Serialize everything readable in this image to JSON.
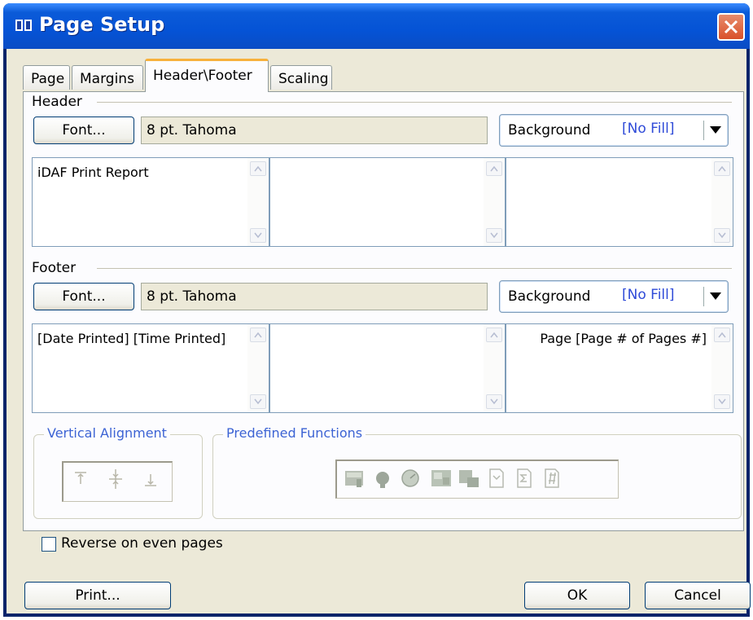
{
  "window": {
    "title": "Page Setup"
  },
  "tabs": [
    "Page",
    "Margins",
    "Header\\Footer",
    "Scaling"
  ],
  "header": {
    "section_label": "Header",
    "font_button": "Font...",
    "font_value": "8 pt. Tahoma",
    "background_label": "Background",
    "background_value": "[No Fill]",
    "left_text": "iDAF Print Report",
    "center_text": "",
    "right_text": ""
  },
  "footer": {
    "section_label": "Footer",
    "font_button": "Font...",
    "font_value": "8 pt. Tahoma",
    "background_label": "Background",
    "background_value": "[No Fill]",
    "left_text": "[Date Printed] [Time Printed]",
    "center_text": "",
    "right_text": "Page [Page # of Pages #]"
  },
  "vertical_alignment": {
    "label": "Vertical Alignment"
  },
  "predefined_functions": {
    "label": "Predefined Functions"
  },
  "reverse_checkbox": {
    "label": "Reverse on even pages",
    "checked": false
  },
  "buttons": {
    "print": "Print...",
    "ok": "OK",
    "cancel": "Cancel"
  },
  "colors": {
    "titlebar": "#0553d6",
    "dialog_bg": "#ece9d8",
    "panel_bg": "#fcfcfe",
    "group_label": "#3c63d4",
    "tab_highlight": "#f7b13b"
  }
}
